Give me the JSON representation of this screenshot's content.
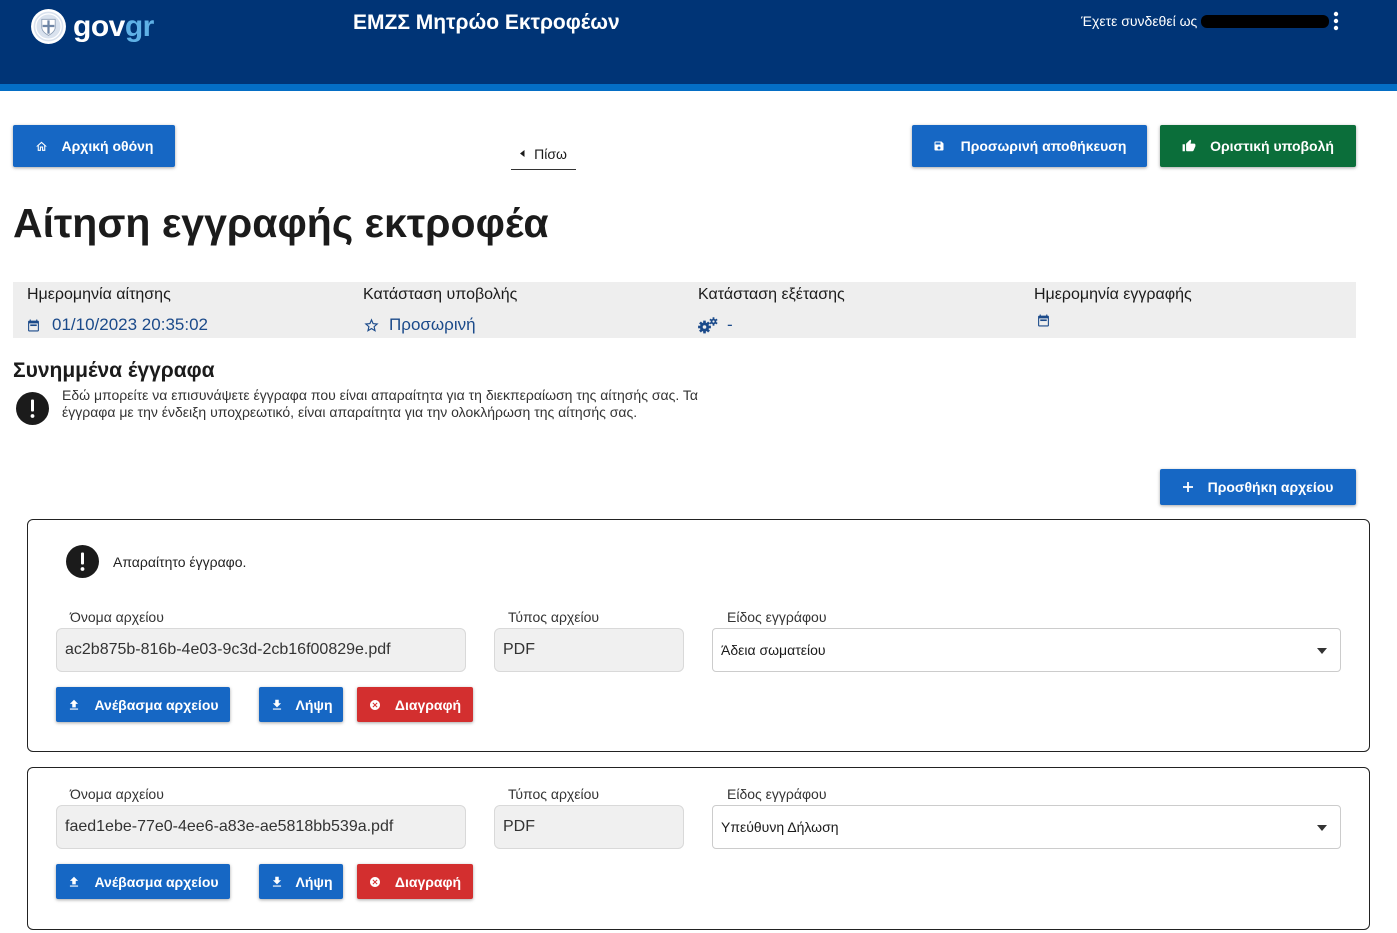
{
  "colors": {
    "header_bar": "#003476",
    "header_stripe": "#046ec5",
    "primary": "#1667c4",
    "success": "#0b6e3a",
    "danger": "#d32f2f",
    "info_band": "#eeeeee",
    "status_text": "#1b4a8a"
  },
  "header": {
    "logo": {
      "icon": "govgr-emblem-icon",
      "text_gov": "gov",
      "text_gr": "gr"
    },
    "app_title": "ΕΜΖΣ Μητρώο Εκτροφέων",
    "logged_in_label": "Έχετε συνδεθεί ως",
    "menu_icon": "more-vert-icon"
  },
  "toolbar": {
    "home": {
      "label": "Αρχική οθόνη",
      "icon": "home-icon"
    },
    "back": {
      "label": "Πίσω",
      "icon": "chevron-left-icon"
    },
    "save_draft": {
      "label": "Προσωρινή αποθήκευση",
      "icon": "save-icon"
    },
    "submit": {
      "label": "Οριστική υποβολή",
      "icon": "thumbs-up-icon"
    }
  },
  "page": {
    "title": "Αίτηση εγγραφής εκτροφέα"
  },
  "status_band": [
    {
      "label": "Ημερομηνία αίτησης",
      "icon": "calendar-icon",
      "value": "01/10/2023 20:35:02"
    },
    {
      "label": "Κατάσταση υποβολής",
      "icon": "star-outline-icon",
      "value": "Προσωρινή"
    },
    {
      "label": "Κατάσταση εξέτασης",
      "icon": "gears-icon",
      "value": "-"
    },
    {
      "label": "Ημερομηνία εγγραφής",
      "icon": "calendar-icon"
    }
  ],
  "attachments": {
    "heading": "Συνημμένα έγγραφα",
    "info_icon": "exclamation-circle-icon",
    "info_text": "Εδώ μπορείτε να επισυνάψετε έγγραφα που είναι απαραίτητα για τη διεκπεραίωση της αίτησής σας. Τα έγγραφα με την ένδειξη υποχρεωτικό, είναι απαραίτητα για την ολοκλήρωση της αίτησής σας.",
    "add_button": {
      "label": "Προσθήκη αρχείου",
      "icon": "plus-icon"
    },
    "field_labels": {
      "file_name": "Όνομα αρχείου",
      "file_type": "Τύπος αρχείου",
      "document_type": "Είδος εγγράφου"
    },
    "actions": {
      "upload": {
        "label": "Ανέβασμα αρχείου",
        "icon": "upload-icon"
      },
      "download": {
        "label": "Λήψη",
        "icon": "download-icon"
      },
      "delete": {
        "label": "Διαγραφή",
        "icon": "close-circle-icon"
      }
    },
    "items": [
      {
        "required_notice": "Απαραίτητο έγγραφο.",
        "notice_icon": "exclamation-circle-icon",
        "file_name": "ac2b875b-816b-4e03-9c3d-2cb16f00829e.pdf",
        "file_type": "PDF",
        "document_type": "Άδεια σωματείου"
      },
      {
        "file_name": "faed1ebe-77e0-4ee6-a83e-ae5818bb539a.pdf",
        "file_type": "PDF",
        "document_type": "Υπεύθυνη Δήλωση"
      }
    ]
  }
}
